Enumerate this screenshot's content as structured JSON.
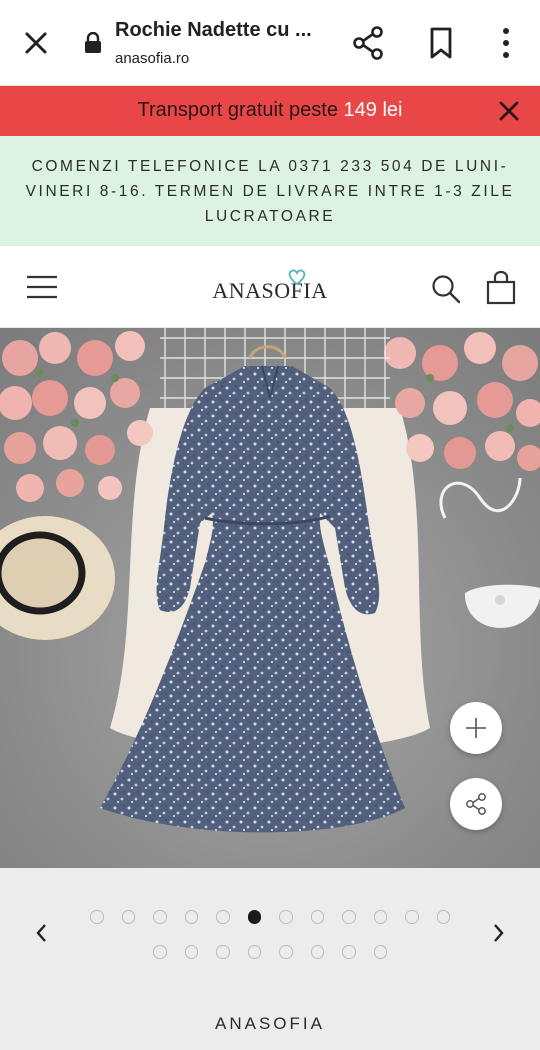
{
  "browser": {
    "page_title": "Rochie Nadette cu ...",
    "url": "anasofia.ro"
  },
  "promo": {
    "text_before": "Transport gratuit peste ",
    "amount": "149 lei"
  },
  "info_banner": {
    "text": "COMENZI TELEFONICE LA 0371 233 504 DE LUNI-VINERI 8-16. TERMEN DE LIVRARE INTRE 1-3 ZILE LUCRATOARE"
  },
  "site_header": {
    "logo_text": "ANASOFIA"
  },
  "gallery": {
    "total_images": 20,
    "row1_count": 12,
    "row2_count": 8,
    "active_index": 5
  },
  "product": {
    "brand": "ANASOFIA"
  },
  "colors": {
    "promo_bg": "#e94747",
    "info_bg": "#dcf3e2",
    "logo_accent": "#4fb6b8",
    "gallery_bg": "#ececec"
  },
  "icons": [
    "close-icon",
    "lock-icon",
    "share-icon",
    "bookmark-icon",
    "more-icon",
    "menu-icon",
    "search-icon",
    "bag-icon",
    "plus-icon",
    "chevron-left-icon",
    "chevron-right-icon"
  ]
}
